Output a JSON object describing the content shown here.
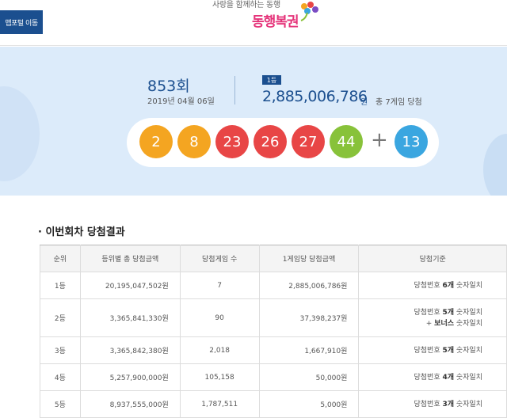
{
  "header": {
    "portal_button": "맵포털 이동",
    "slogan": "사랑을 함께하는 동행",
    "logo": "동행복권"
  },
  "draw": {
    "round": "853회",
    "date": "2019년 04월 06일",
    "rank_badge": "1등",
    "first_prize_amount": "2,885,006,786",
    "won_unit": "원",
    "winners_text": "총 7게임 당첨",
    "numbers": [
      {
        "value": "2",
        "color": "#f4a521"
      },
      {
        "value": "8",
        "color": "#f4a521"
      },
      {
        "value": "23",
        "color": "#e84646"
      },
      {
        "value": "26",
        "color": "#e84646"
      },
      {
        "value": "27",
        "color": "#e84646"
      },
      {
        "value": "44",
        "color": "#88c23a"
      }
    ],
    "plus": "+",
    "bonus": {
      "value": "13",
      "color": "#3aa6e0"
    }
  },
  "results": {
    "title": "·  이번회차 당첨결과",
    "headers": [
      "순위",
      "등위별 총 당첨금액",
      "당첨게임 수",
      "1게임당 당첨금액",
      "당첨기준"
    ],
    "rows": [
      {
        "rank": "1등",
        "total": "20,195,047,502원",
        "games": "7",
        "per_game": "2,885,006,786원",
        "crit_pre": "당첨번호 ",
        "crit_em": "6개",
        "crit_post": " 숫자일치",
        "crit_line2": ""
      },
      {
        "rank": "2등",
        "total": "3,365,841,330원",
        "games": "90",
        "per_game": "37,398,237원",
        "crit_pre": "당첨번호 ",
        "crit_em": "5개",
        "crit_post": " 숫자일치",
        "crit_line2_pre": "+ ",
        "crit_line2_em": "보너스",
        "crit_line2_post": " 숫자일치"
      },
      {
        "rank": "3등",
        "total": "3,365,842,380원",
        "games": "2,018",
        "per_game": "1,667,910원",
        "crit_pre": "당첨번호 ",
        "crit_em": "5개",
        "crit_post": " 숫자일치",
        "crit_line2": ""
      },
      {
        "rank": "4등",
        "total": "5,257,900,000원",
        "games": "105,158",
        "per_game": "50,000원",
        "crit_pre": "당첨번호 ",
        "crit_em": "4개",
        "crit_post": " 숫자일치",
        "crit_line2": ""
      },
      {
        "rank": "5등",
        "total": "8,937,555,000원",
        "games": "1,787,511",
        "per_game": "5,000원",
        "crit_pre": "당첨번호 ",
        "crit_em": "3개",
        "crit_post": " 숫자일치",
        "crit_line2": ""
      }
    ]
  }
}
